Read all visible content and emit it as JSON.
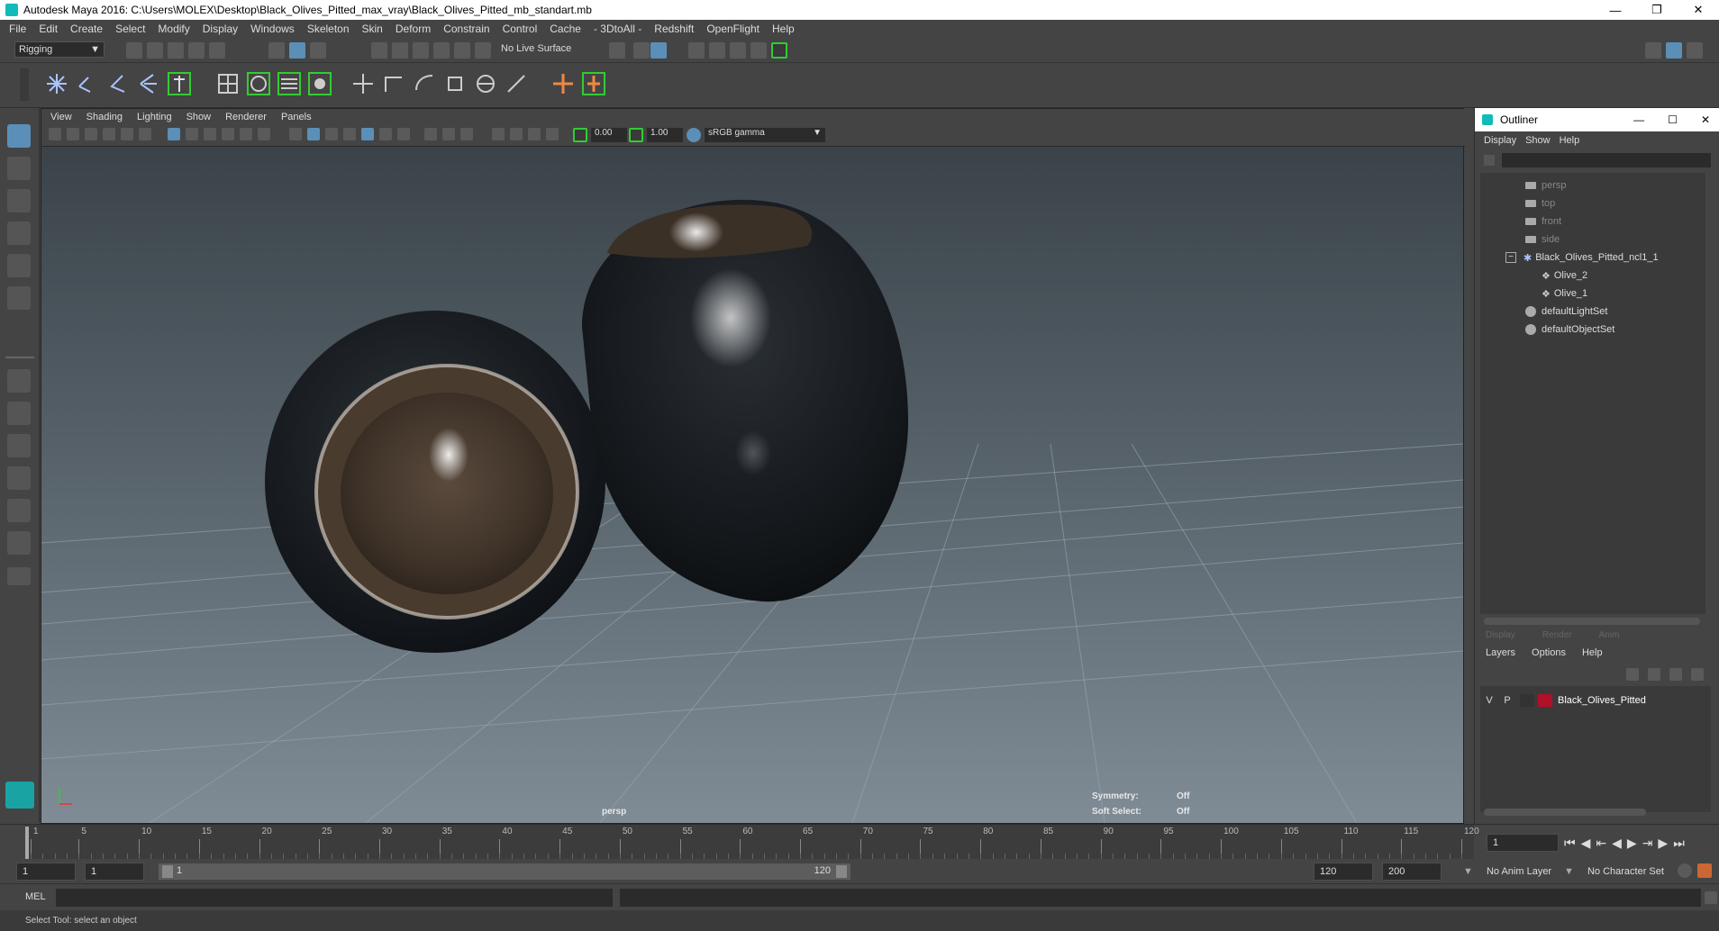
{
  "window": {
    "title": "Autodesk Maya 2016: C:\\Users\\MOLEX\\Desktop\\Black_Olives_Pitted_max_vray\\Black_Olives_Pitted_mb_standart.mb"
  },
  "menubar": [
    "File",
    "Edit",
    "Create",
    "Select",
    "Modify",
    "Display",
    "Windows",
    "Skeleton",
    "Skin",
    "Deform",
    "Constrain",
    "Control",
    "Cache",
    "- 3DtoAll -",
    "Redshift",
    "OpenFlight",
    "Help"
  ],
  "statusline": {
    "mode": "Rigging",
    "live_surface": "No Live Surface"
  },
  "viewport": {
    "menu": [
      "View",
      "Shading",
      "Lighting",
      "Show",
      "Renderer",
      "Panels"
    ],
    "exposure": "0.00",
    "gamma": "1.00",
    "color_space": "sRGB gamma",
    "camera_label": "persp",
    "hud": {
      "symmetry_label": "Symmetry:",
      "symmetry_value": "Off",
      "soft_select_label": "Soft Select:",
      "soft_select_value": "Off"
    }
  },
  "outliner": {
    "title": "Outliner",
    "menu": [
      "Display",
      "Show",
      "Help"
    ],
    "items": [
      {
        "label": "persp",
        "dim": true,
        "indent": 0,
        "icon": "camera-icon"
      },
      {
        "label": "top",
        "dim": true,
        "indent": 0,
        "icon": "camera-icon"
      },
      {
        "label": "front",
        "dim": true,
        "indent": 0,
        "icon": "camera-icon"
      },
      {
        "label": "side",
        "dim": true,
        "indent": 0,
        "icon": "camera-icon"
      },
      {
        "label": "Black_Olives_Pitted_ncl1_1",
        "dim": false,
        "indent": 0,
        "icon": "group-icon"
      },
      {
        "label": "Olive_2",
        "dim": false,
        "indent": 1,
        "icon": "mesh-icon"
      },
      {
        "label": "Olive_1",
        "dim": false,
        "indent": 1,
        "icon": "mesh-icon"
      },
      {
        "label": "defaultLightSet",
        "dim": false,
        "indent": 0,
        "icon": "set-icon"
      },
      {
        "label": "defaultObjectSet",
        "dim": false,
        "indent": 0,
        "icon": "set-icon"
      }
    ]
  },
  "layers": {
    "tabs": [
      "Display",
      "Render",
      "Anim"
    ],
    "menu": [
      "Layers",
      "Options",
      "Help"
    ],
    "row": {
      "v": "V",
      "p": "P",
      "name": "Black_Olives_Pitted",
      "color": "#b0102a"
    }
  },
  "timeline": {
    "ticks": [
      "1",
      "5",
      "10",
      "15",
      "20",
      "25",
      "30",
      "35",
      "40",
      "45",
      "50",
      "55",
      "60",
      "65",
      "70",
      "75",
      "80",
      "85",
      "90",
      "95",
      "100",
      "105",
      "110",
      "115",
      "120"
    ],
    "current_frame": "1"
  },
  "range": {
    "start": "1",
    "playback_start": "1",
    "slider_start": "1",
    "slider_end": "120",
    "playback_end": "120",
    "end": "200",
    "anim_layer": "No Anim Layer",
    "character_set": "No Character Set"
  },
  "command": {
    "lang": "MEL"
  },
  "help_line": "Select Tool: select an object"
}
